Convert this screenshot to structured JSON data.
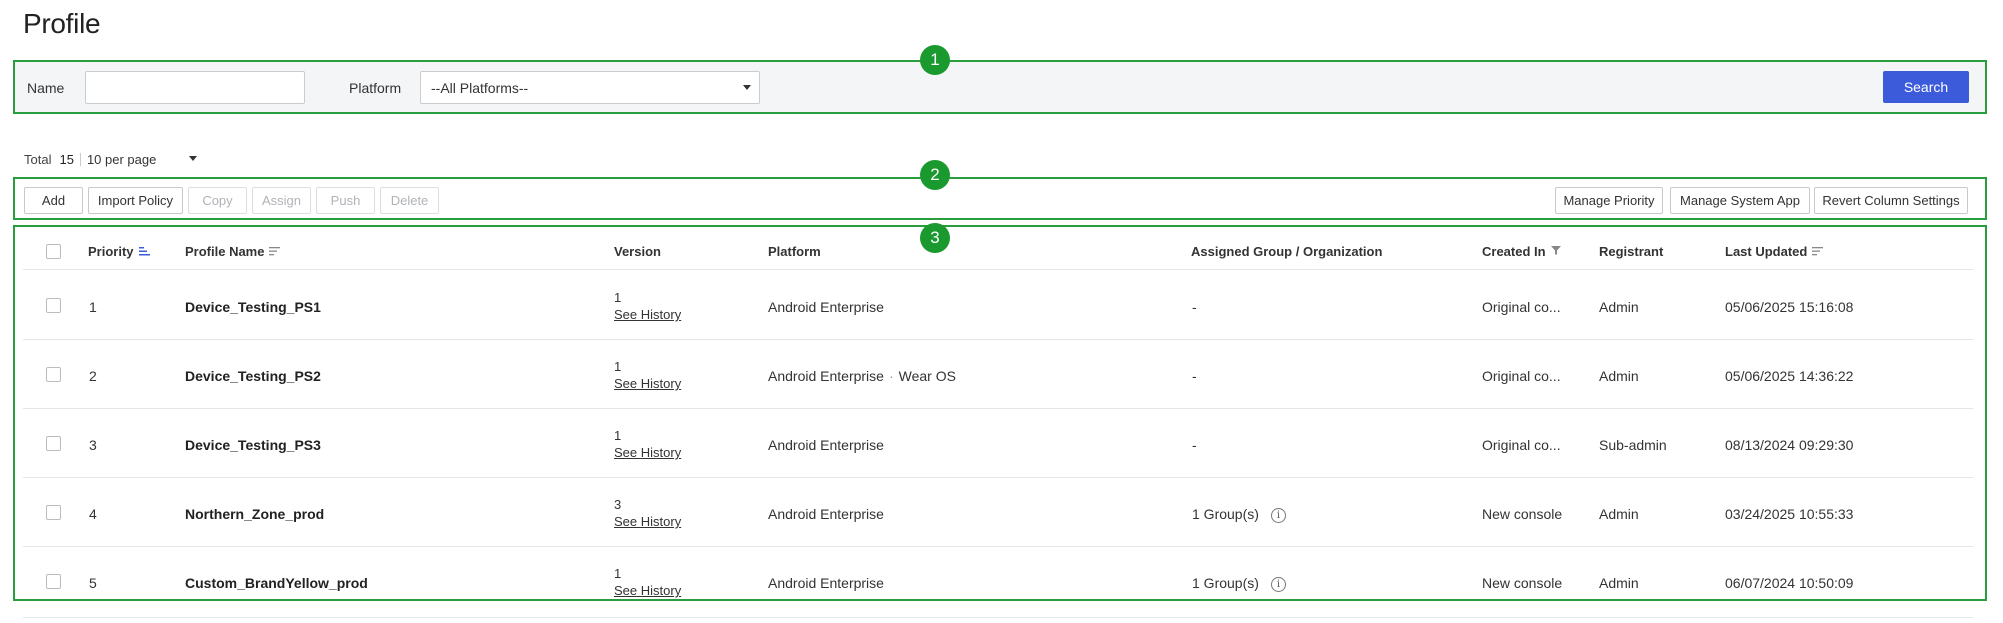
{
  "page": {
    "title": "Profile"
  },
  "badges": [
    "1",
    "2",
    "3"
  ],
  "filter": {
    "name_label": "Name",
    "name_value": "",
    "platform_label": "Platform",
    "platform_selected": "--All Platforms--",
    "search_label": "Search"
  },
  "summary": {
    "total_label": "Total",
    "total_count": "15",
    "per_page": "10 per page"
  },
  "toolbar": {
    "left": [
      {
        "label": "Add",
        "enabled": true
      },
      {
        "label": "Import Policy",
        "enabled": true
      },
      {
        "label": "Copy",
        "enabled": false
      },
      {
        "label": "Assign",
        "enabled": false
      },
      {
        "label": "Push",
        "enabled": false
      },
      {
        "label": "Delete",
        "enabled": false
      }
    ],
    "right": [
      {
        "label": "Manage Priority",
        "enabled": true
      },
      {
        "label": "Manage System App",
        "enabled": true
      },
      {
        "label": "Revert Column Settings",
        "enabled": true
      }
    ]
  },
  "table": {
    "columns": {
      "priority": "Priority",
      "profile_name": "Profile Name",
      "version": "Version",
      "platform": "Platform",
      "assigned": "Assigned Group / Organization",
      "created_in": "Created In",
      "registrant": "Registrant",
      "last_updated": "Last Updated"
    },
    "see_history_label": "See History",
    "rows": [
      {
        "priority": "1",
        "name": "Device_Testing_PS1",
        "version": "1",
        "platform": "Android Enterprise",
        "platform_extra": "",
        "assigned": "-",
        "assigned_info": false,
        "created_in": "Original co...",
        "registrant": "Admin",
        "last_updated": "05/06/2025 15:16:08"
      },
      {
        "priority": "2",
        "name": "Device_Testing_PS2",
        "version": "1",
        "platform": "Android Enterprise",
        "platform_extra": "Wear OS",
        "assigned": "-",
        "assigned_info": false,
        "created_in": "Original co...",
        "registrant": "Admin",
        "last_updated": "05/06/2025 14:36:22"
      },
      {
        "priority": "3",
        "name": "Device_Testing_PS3",
        "version": "1",
        "platform": "Android Enterprise",
        "platform_extra": "",
        "assigned": "-",
        "assigned_info": false,
        "created_in": "Original co...",
        "registrant": "Sub-admin",
        "last_updated": "08/13/2024 09:29:30"
      },
      {
        "priority": "4",
        "name": "Northern_Zone_prod",
        "version": "3",
        "platform": "Android Enterprise",
        "platform_extra": "",
        "assigned": "1 Group(s)",
        "assigned_info": true,
        "created_in": "New console",
        "registrant": "Admin",
        "last_updated": "03/24/2025 10:55:33"
      },
      {
        "priority": "5",
        "name": "Custom_BrandYellow_prod",
        "version": "1",
        "platform": "Android Enterprise",
        "platform_extra": "",
        "assigned": "1 Group(s)",
        "assigned_info": true,
        "created_in": "New console",
        "registrant": "Admin",
        "last_updated": "06/07/2024 10:50:09"
      }
    ]
  }
}
